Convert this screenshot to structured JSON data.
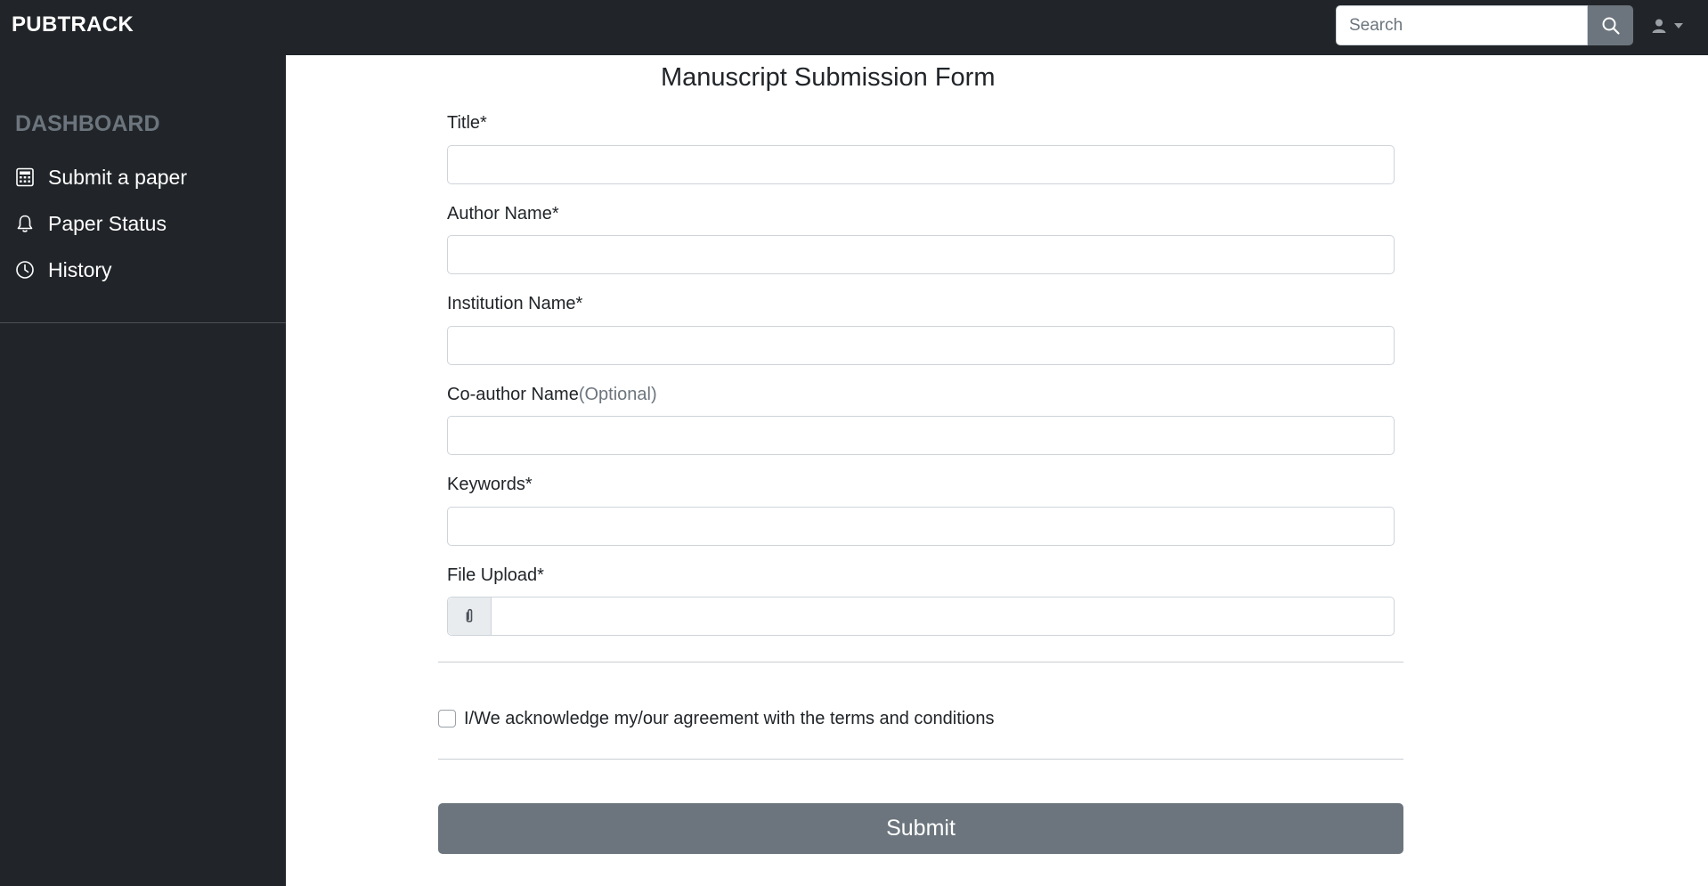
{
  "navbar": {
    "brand": "PUBTRACK",
    "search_placeholder": "Search",
    "search_icon": "search-icon",
    "user_icon": "user-icon",
    "dropdown_icon": "caret-down-icon"
  },
  "sidebar": {
    "heading": "DASHBOARD",
    "items": [
      {
        "label": "Submit a paper",
        "icon": "calculator-icon"
      },
      {
        "label": "Paper Status",
        "icon": "bell-icon"
      },
      {
        "label": "History",
        "icon": "clock-icon"
      }
    ]
  },
  "form": {
    "title": "Manuscript Submission Form",
    "fields": [
      {
        "label": "Title*",
        "value": ""
      },
      {
        "label": "Author Name*",
        "value": ""
      },
      {
        "label": "Institution Name*",
        "value": ""
      },
      {
        "label": "Co-author Name",
        "optional": "(Optional)",
        "value": ""
      },
      {
        "label": "Keywords*",
        "value": ""
      }
    ],
    "file_upload": {
      "label": "File Upload*",
      "icon": "paperclip-icon",
      "value": ""
    },
    "agreement": {
      "label": "I/We acknowledge my/our agreement with the terms and conditions",
      "checked": false
    },
    "submit_label": "Submit"
  },
  "colors": {
    "dark": "#212529",
    "muted": "#6c757d",
    "border": "#ced4da",
    "addon_bg": "#e9ecef"
  }
}
